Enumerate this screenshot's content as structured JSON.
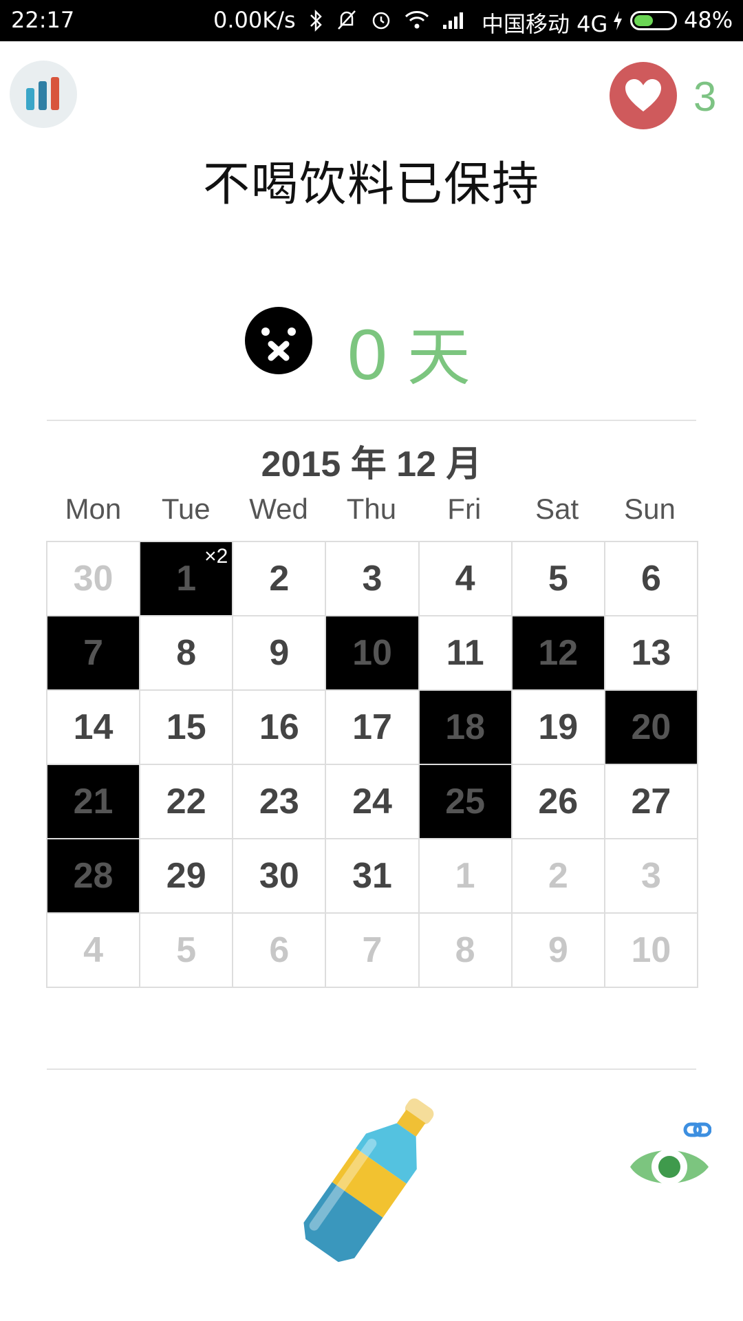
{
  "status_bar": {
    "time": "22:17",
    "net_speed": "0.00K/s",
    "carrier": "中国移动 4G",
    "battery": "48%",
    "battery_level": 0.48
  },
  "header": {
    "like_count": "3",
    "title": "不喝饮料已保持"
  },
  "streak": {
    "value": "0",
    "unit": "天"
  },
  "calendar": {
    "title": "2015 年 12 月",
    "weekdays": [
      "Mon",
      "Tue",
      "Wed",
      "Thu",
      "Fri",
      "Sat",
      "Sun"
    ],
    "days": [
      {
        "n": "30",
        "muted": true
      },
      {
        "n": "1",
        "marked": true,
        "mult": "×2"
      },
      {
        "n": "2"
      },
      {
        "n": "3"
      },
      {
        "n": "4"
      },
      {
        "n": "5"
      },
      {
        "n": "6"
      },
      {
        "n": "7",
        "marked": true
      },
      {
        "n": "8"
      },
      {
        "n": "9"
      },
      {
        "n": "10",
        "marked": true
      },
      {
        "n": "11"
      },
      {
        "n": "12",
        "marked": true
      },
      {
        "n": "13"
      },
      {
        "n": "14"
      },
      {
        "n": "15"
      },
      {
        "n": "16"
      },
      {
        "n": "17"
      },
      {
        "n": "18",
        "marked": true
      },
      {
        "n": "19"
      },
      {
        "n": "20",
        "marked": true
      },
      {
        "n": "21",
        "marked": true
      },
      {
        "n": "22"
      },
      {
        "n": "23"
      },
      {
        "n": "24"
      },
      {
        "n": "25",
        "marked": true
      },
      {
        "n": "26"
      },
      {
        "n": "27"
      },
      {
        "n": "28",
        "marked": true
      },
      {
        "n": "29"
      },
      {
        "n": "30"
      },
      {
        "n": "31"
      },
      {
        "n": "1",
        "muted": true
      },
      {
        "n": "2",
        "muted": true
      },
      {
        "n": "3",
        "muted": true
      },
      {
        "n": "4",
        "muted": true
      },
      {
        "n": "5",
        "muted": true
      },
      {
        "n": "6",
        "muted": true
      },
      {
        "n": "7",
        "muted": true
      },
      {
        "n": "8",
        "muted": true
      },
      {
        "n": "9",
        "muted": true
      },
      {
        "n": "10",
        "muted": true
      }
    ]
  },
  "icons": {
    "stats": "bar-chart-icon",
    "like": "heart-icon",
    "mood": "mute-face-icon",
    "bottle": "soda-bottle-icon",
    "eye": "eye-link-icon"
  },
  "colors": {
    "accent_green": "#7cc57f",
    "like_red": "#cf5a5c",
    "marked_day": "#000000"
  }
}
